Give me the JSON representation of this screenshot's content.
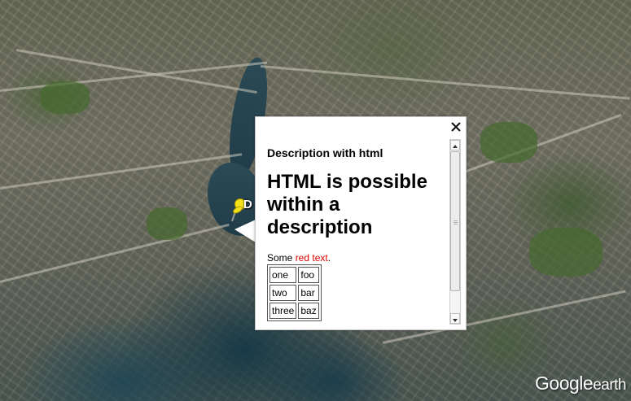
{
  "balloon": {
    "subtitle": "Description with html",
    "heading": "HTML is possible within a description",
    "text_prefix": "Some ",
    "text_red": "red text",
    "text_suffix": ".",
    "table": [
      [
        "one",
        "foo"
      ],
      [
        "two",
        "bar"
      ],
      [
        "three",
        "baz"
      ]
    ],
    "scroll_position": 0
  },
  "placemark": {
    "label_visible": "D"
  },
  "logo": {
    "google": "Google",
    "earth": "earth"
  },
  "colors": {
    "red_text": "#e00000",
    "water": "#1f3c48"
  }
}
